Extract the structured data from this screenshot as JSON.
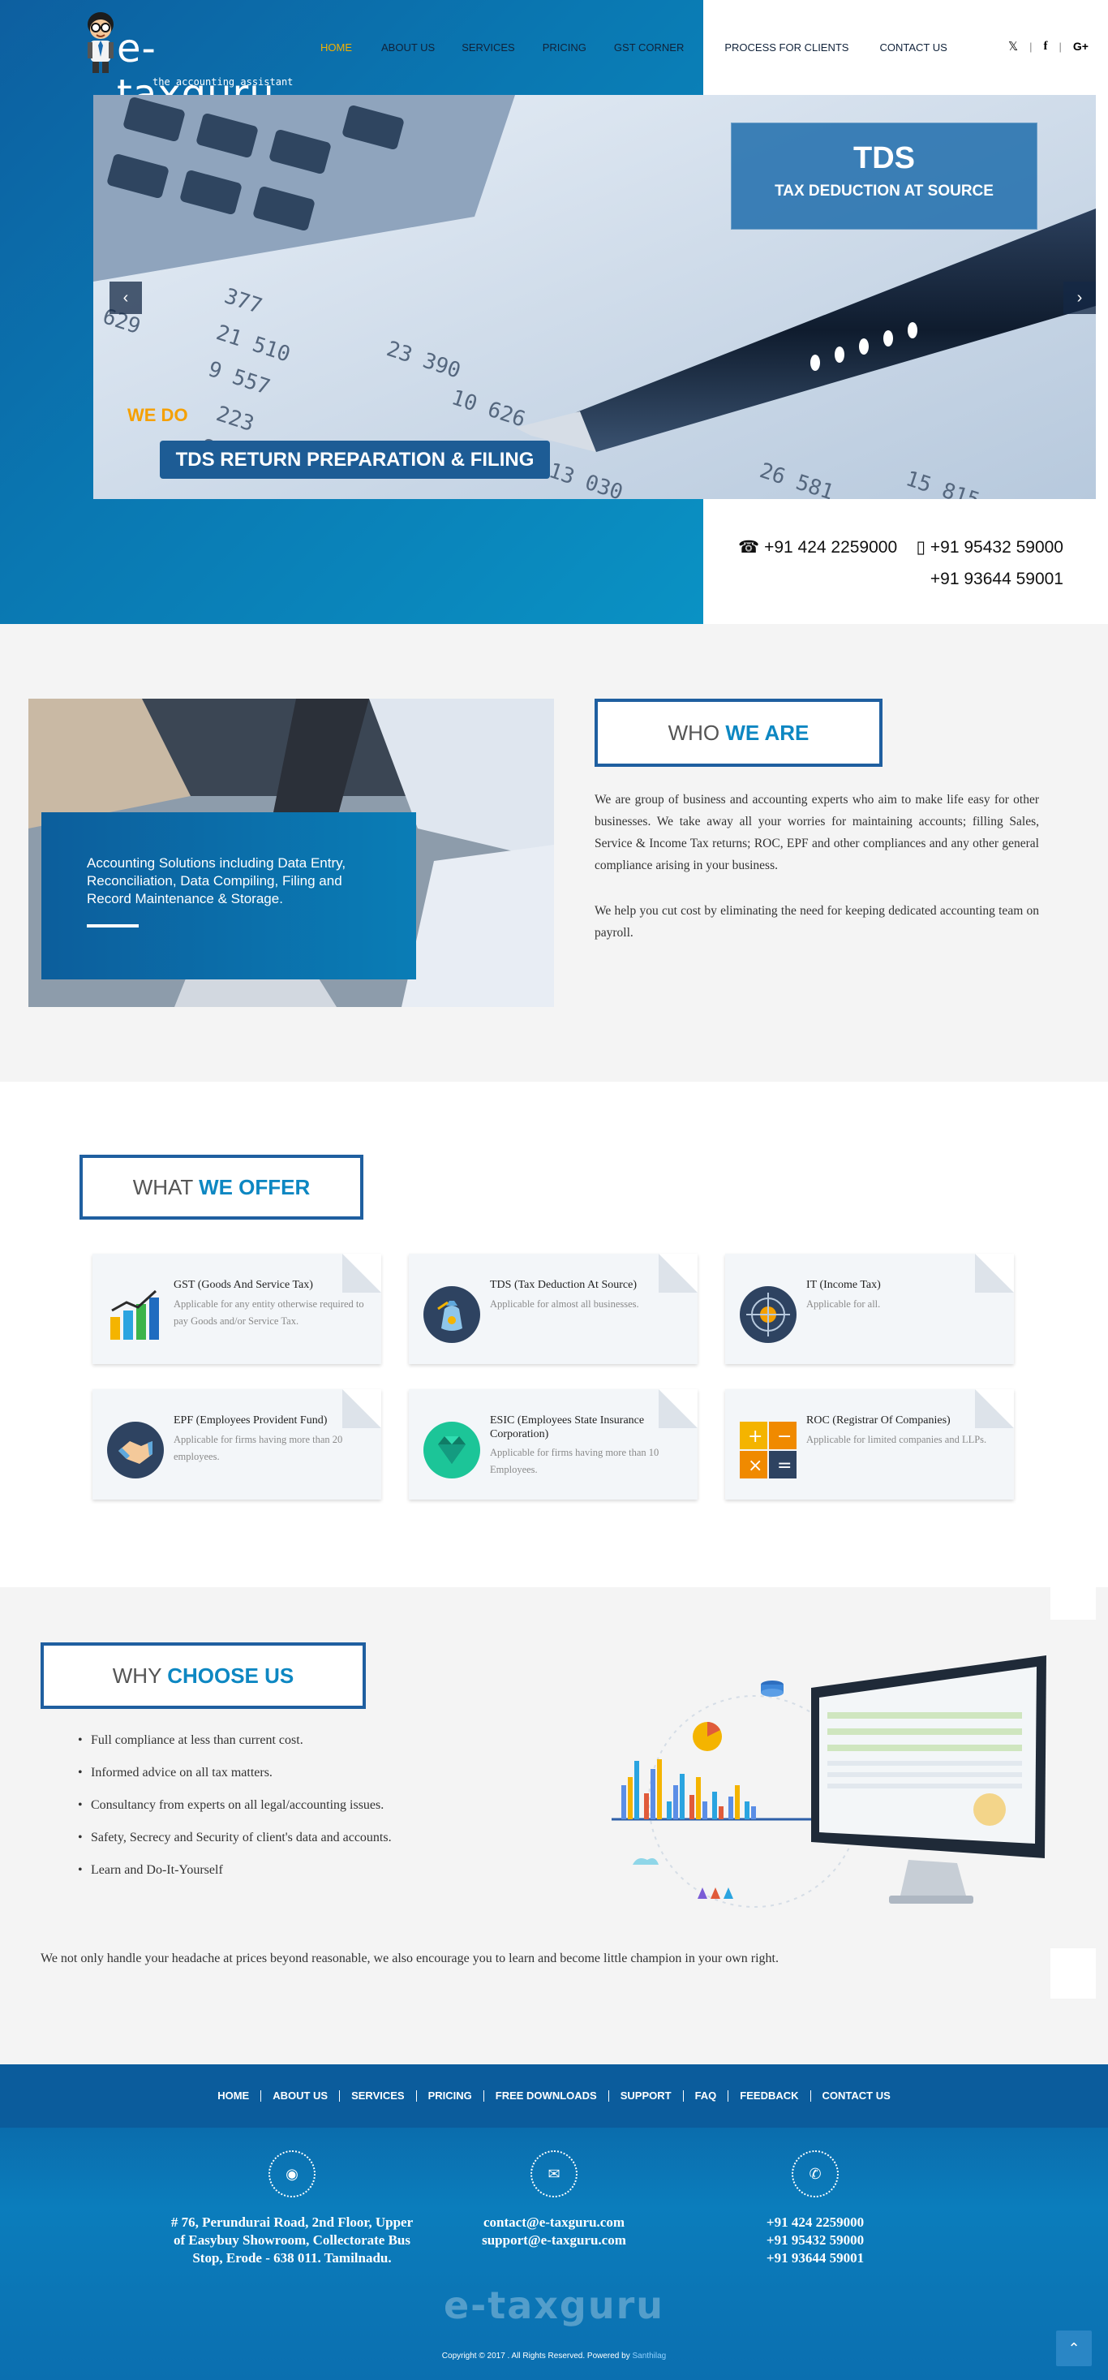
{
  "header": {
    "brand_text": "e-taxguru",
    "tagline": "the accounting assistant",
    "nav": [
      "HOME",
      "ABOUT US",
      "SERVICES",
      "PRICING",
      "GST CORNER",
      "PROCESS FOR CLIENTS",
      "CONTACT US"
    ],
    "social": [
      "twitter-icon",
      "facebook-icon",
      "google-plus-icon"
    ]
  },
  "slider": {
    "title": "TDS",
    "subtitle": "TAX DEDUCTION AT SOURCE",
    "we_do": "WE DO",
    "button": "TDS RETURN PREPARATION & FILING",
    "prev": "‹",
    "next": "›"
  },
  "phones": {
    "phone1": "+91 424 2259000",
    "mobile1": "+91 95432 59000",
    "mobile2": "+91 93644 59001"
  },
  "who": {
    "title_normal": "WHO",
    "title_bold": "WE ARE",
    "card_text": "Accounting Solutions including Data Entry, Reconciliation, Data Compiling, Filing and Record Maintenance & Storage.",
    "para1": "We are group of business and accounting experts who aim to make life easy for other businesses. We take away all  your worries for maintaining accounts; filling Sales, Service & Income Tax returns; ROC, EPF and other compliances and any other general compliance arising in your business.",
    "para2": "We help you cut cost by eliminating the need for keeping dedicated accounting team on payroll."
  },
  "offer": {
    "title_normal": "WHAT",
    "title_bold": "WE OFFER",
    "items": [
      {
        "title": "GST (Goods And Service Tax)",
        "desc": "Applicable for any entity otherwise required to pay Goods and/or Service Tax.",
        "icon": "bar-chart-icon"
      },
      {
        "title": "TDS (Tax Deduction At Source)",
        "desc": "Applicable for almost all businesses.",
        "icon": "money-bag-icon"
      },
      {
        "title": "IT (Income Tax)",
        "desc": "Applicable for all.",
        "icon": "target-icon"
      },
      {
        "title": "EPF (Employees Provident Fund)",
        "desc": "Applicable for firms having more than 20 employees.",
        "icon": "handshake-icon"
      },
      {
        "title": "ESIC (Employees State Insurance Corporation)",
        "desc": "Applicable for firms having more than 10 Employees.",
        "icon": "diamond-icon"
      },
      {
        "title": "ROC (Registrar Of Companies)",
        "desc": "Applicable for limited companies and LLPs.",
        "icon": "calculator-icon"
      }
    ]
  },
  "why": {
    "title_normal": "WHY",
    "title_bold": "CHOOSE US",
    "points": [
      "Full compliance at less than current cost.",
      "Informed advice on all tax matters.",
      "Consultancy from experts on all legal/accounting issues.",
      "Safety, Secrecy and Security of client's data and accounts.",
      "Learn and Do-It-Yourself"
    ],
    "closing": "We not only handle your headache at prices beyond reasonable, we also encourage you to learn and become little champion in your own right."
  },
  "footer": {
    "nav": [
      "HOME",
      "ABOUT US",
      "SERVICES",
      "PRICING",
      "FREE DOWNLOADS",
      "SUPPORT",
      "FAQ",
      "FEEDBACK",
      "CONTACT US"
    ],
    "address": "# 76, Perundurai Road, 2nd Floor, Upper of Easybuy Showroom, Collectorate Bus Stop, Erode - 638 011. Tamilnadu.",
    "email1": "contact@e-taxguru.com",
    "email2": "support@e-taxguru.com",
    "phone1": "+91 424 2259000",
    "phone2": "+91 95432 59000",
    "phone3": "+91 93644 59001",
    "brand": "e-taxguru",
    "copyright": "Copyright © 2017 . All Rights Reserved. Powered by",
    "powered_by": "Santhilag"
  },
  "colors": {
    "primary_blue": "#0b6fb0",
    "accent_cyan": "#0d87c2",
    "nav_active": "#f4b000",
    "we_do_orange": "#f5a000"
  }
}
